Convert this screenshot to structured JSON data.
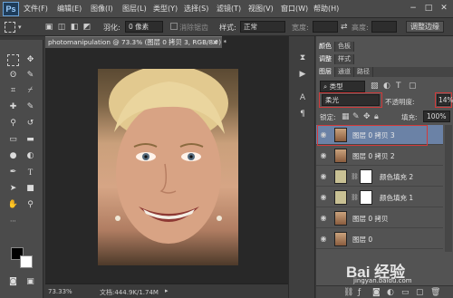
{
  "app": {
    "logo": "Ps"
  },
  "menu": [
    "文件(F)",
    "编辑(E)",
    "图像(I)",
    "图层(L)",
    "类型(Y)",
    "选择(S)",
    "滤镜(T)",
    "视图(V)",
    "窗口(W)",
    "帮助(H)"
  ],
  "window_controls": [
    "−",
    "□",
    "✕"
  ],
  "options": {
    "feather_label": "羽化:",
    "feather_value": "0 像素",
    "antialias_label": "消除锯齿",
    "style_label": "样式:",
    "style_value": "正常",
    "width_label": "宽度:",
    "height_label": "高度:",
    "refine_edge": "调整边缘"
  },
  "document": {
    "title": "photomanipulation @ 73.3% (图层 0 拷贝 3, RGB/8#) *",
    "zoom": "73.33%",
    "doc_size": "文档:444.9K/1.74M"
  },
  "panel_tabs_top": [
    "颜色",
    "色板"
  ],
  "panel_tabs_mid": [
    "调整",
    "样式"
  ],
  "panel_tabs_layers": [
    "图层",
    "通道",
    "路径"
  ],
  "layers_panel": {
    "filter_label": "类型",
    "blend_mode": "柔光",
    "opacity_label": "不透明度:",
    "opacity_value": "14%",
    "lock_label": "锁定:",
    "fill_label": "填充:",
    "fill_value": "100%"
  },
  "layers": [
    {
      "name": "图层 0 拷贝 3",
      "thumb": "photo",
      "selected": true
    },
    {
      "name": "图层 0 拷贝 2",
      "thumb": "photo",
      "selected": false
    },
    {
      "name": "颜色填充 2",
      "thumb": "fill",
      "selected": false
    },
    {
      "name": "颜色填充 1",
      "thumb": "fill",
      "selected": false
    },
    {
      "name": "图层 0 拷贝",
      "thumb": "photo",
      "selected": false
    },
    {
      "name": "图层 0",
      "thumb": "photo",
      "selected": false
    }
  ],
  "watermark": {
    "text": "Bai 经验",
    "sub": "jingyan.baidu.com"
  },
  "colors": {
    "accent_red": "#d23a3a",
    "selected_layer": "#6b82a6",
    "fill_thumb": "#c9c194"
  }
}
